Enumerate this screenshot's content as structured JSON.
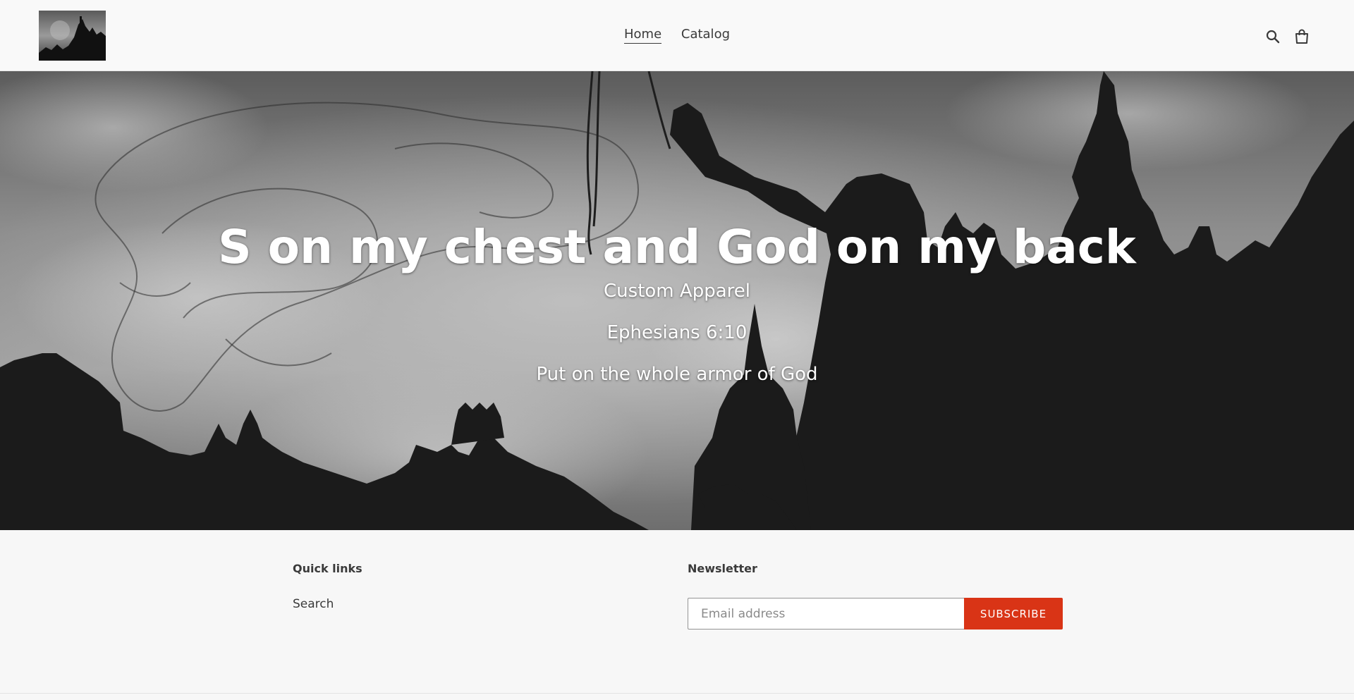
{
  "header": {
    "logo_alt": "S on my chest and God on my back",
    "nav": [
      {
        "label": "Home",
        "active": true
      },
      {
        "label": "Catalog",
        "active": false
      }
    ],
    "icons": [
      "search-icon",
      "cart-icon"
    ]
  },
  "hero": {
    "title": "S on my chest and God on my back",
    "line1": "Custom Apparel",
    "line2": "Ephesians 6:10",
    "line3": "Put on the whole armor of God"
  },
  "footer": {
    "quick_links_heading": "Quick links",
    "quick_links": [
      {
        "label": "Search"
      }
    ],
    "newsletter_heading": "Newsletter",
    "email_placeholder": "Email address",
    "subscribe_label": "SUBSCRIBE"
  },
  "colors": {
    "accent": "#d93416",
    "text": "#3a3a3a",
    "background": "#f7f7f7"
  }
}
